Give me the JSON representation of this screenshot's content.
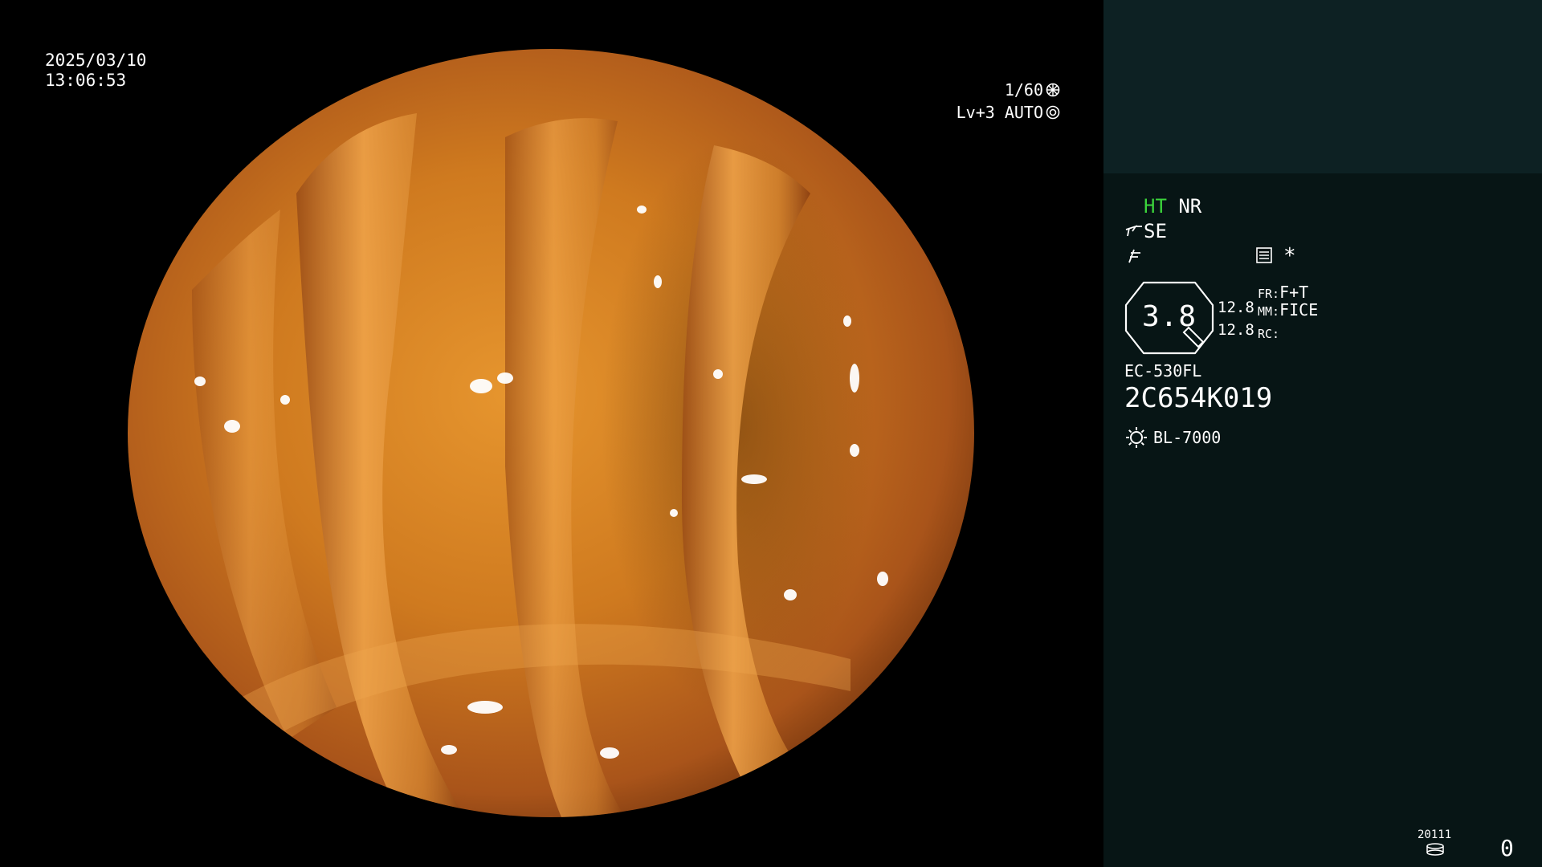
{
  "overlay": {
    "date": "2025/03/10",
    "time": "13:06:53",
    "shutter": "1/60",
    "exposure": "Lv+3 AUTO"
  },
  "panel": {
    "ht": "HT",
    "nr": "NR",
    "se": "SE",
    "asterisk": "*",
    "gauge_value": "3.8",
    "val_top": "12.8",
    "val_bottom": "12.8",
    "fr_label": "FR:",
    "fr_value": "F+T",
    "mm_label": "MM:",
    "mm_value": "FICE",
    "rc_label": "RC:",
    "scope_model": "EC-530FL",
    "scope_serial": "2C654K019",
    "light_source": "BL-7000",
    "storage_code": "20111",
    "counter": "0"
  },
  "icons": [
    "shutter-icon",
    "iris-icon",
    "se-tool-icon",
    "freeze-icon",
    "menu-icon",
    "light-icon",
    "storage-icon"
  ],
  "colors": {
    "panel_bg": "#071515",
    "panel_top_bg": "#0d2123",
    "ht_green": "#3bd43b",
    "tissue": "#c8781e"
  }
}
